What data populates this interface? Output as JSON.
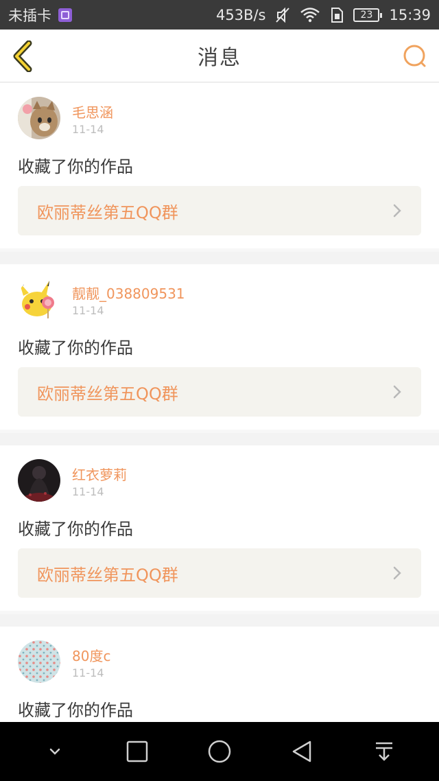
{
  "status_bar": {
    "carrier": "未插卡",
    "speed": "453B/s",
    "battery": "23",
    "time": "15:39"
  },
  "header": {
    "title": "消息",
    "accent_color": "#f0955c"
  },
  "messages": [
    {
      "username": "毛思涵",
      "time": "11-14",
      "action": "收藏了你的作品",
      "work_title": "欧丽蒂丝第五QQ群",
      "avatar": "cat-avatar"
    },
    {
      "username": "靓靓_038809531",
      "time": "11-14",
      "action": "收藏了你的作品",
      "work_title": "欧丽蒂丝第五QQ群",
      "avatar": "pikachu-avatar"
    },
    {
      "username": "红衣萝莉",
      "time": "11-14",
      "action": "收藏了你的作品",
      "work_title": "欧丽蒂丝第五QQ群",
      "avatar": "dark-figure-avatar"
    },
    {
      "username": "80度c",
      "time": "11-14",
      "action": "收藏了你的作品",
      "work_title": "",
      "avatar": "dotted-pattern-avatar"
    }
  ]
}
